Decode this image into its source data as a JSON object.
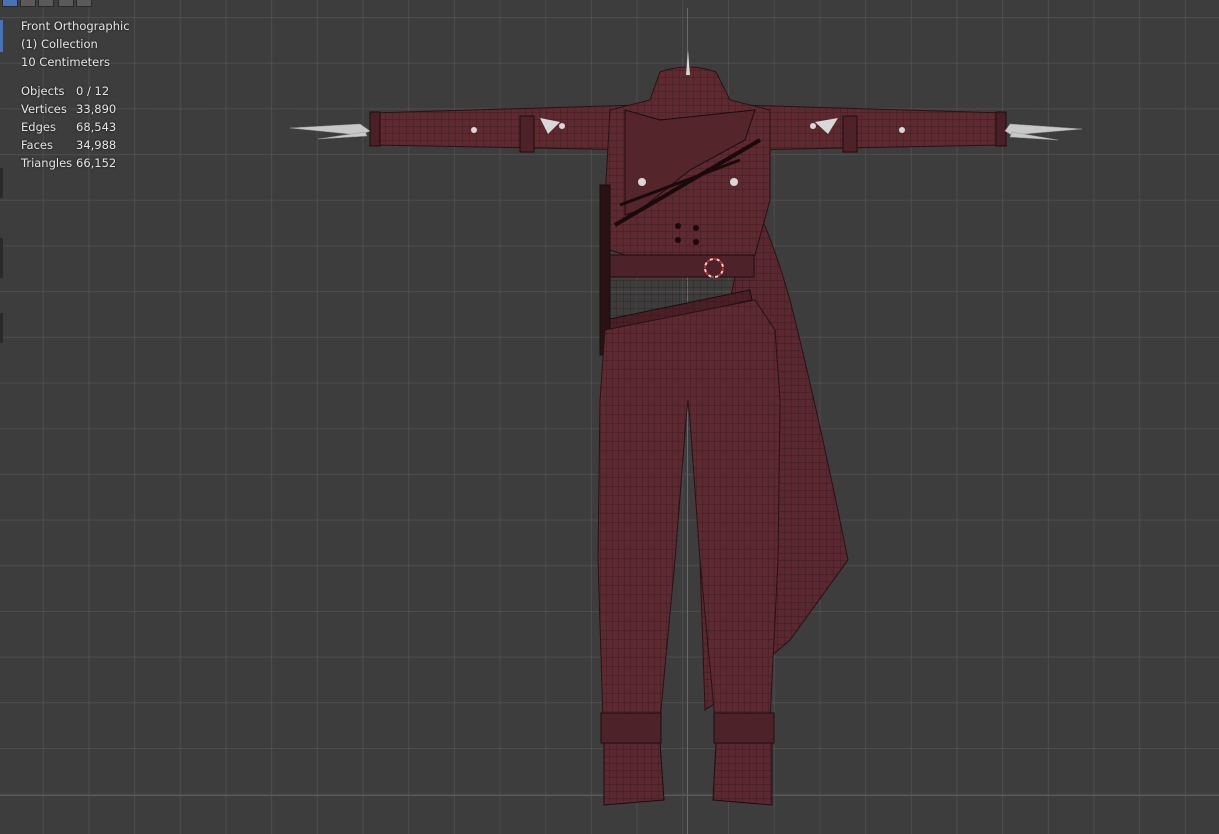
{
  "viewport": {
    "view_name": "Front Orthographic",
    "collection": "(1) Collection",
    "grid_scale": "10 Centimeters"
  },
  "stats": [
    {
      "label": "Objects",
      "value": "0 / 12"
    },
    {
      "label": "Vertices",
      "value": "33,890"
    },
    {
      "label": "Edges",
      "value": "68,543"
    },
    {
      "label": "Faces",
      "value": "34,988"
    },
    {
      "label": "Triangles",
      "value": "66,152"
    }
  ],
  "colors": {
    "background": "#3d3d3d",
    "mesh_fill": "#5e2a31",
    "wire": "#2a1114",
    "axis_y": "#3f6fb0",
    "axis_x": "#a53a45",
    "cursor": "#d12a2a"
  },
  "icons": {
    "toolbar": [
      "select-box-icon",
      "mode-icon",
      "view-icon",
      "snap-icon"
    ],
    "cursor": "3d-cursor-icon"
  }
}
